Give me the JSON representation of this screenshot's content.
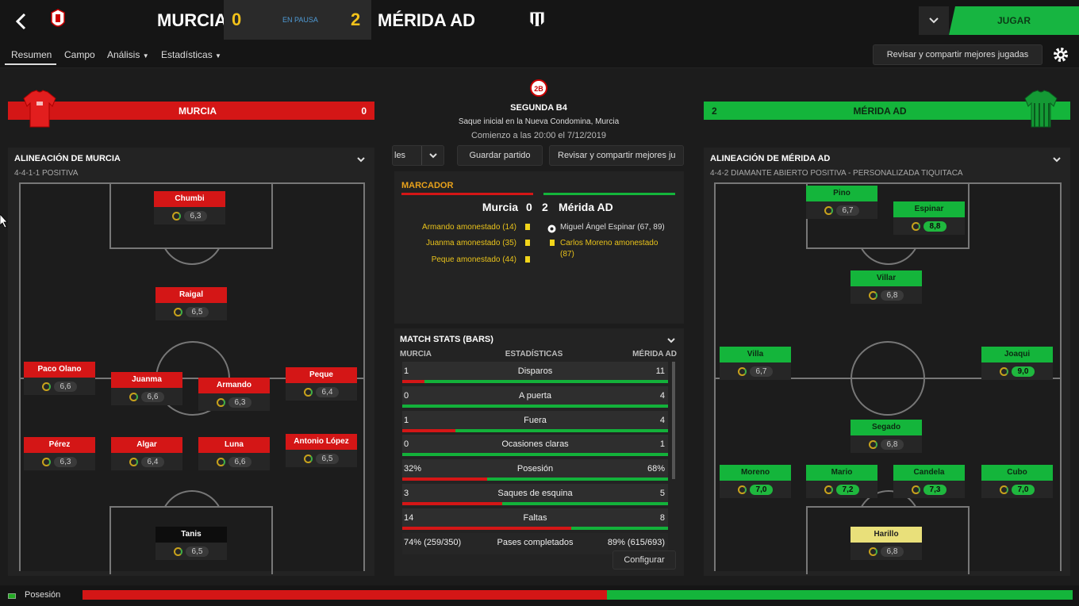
{
  "header": {
    "home_team": "MURCIA",
    "away_team": "MÉRIDA AD",
    "home_score": "0",
    "away_score": "2",
    "status": "EN PAUSA",
    "play_label": "JUGAR"
  },
  "nav": {
    "tabs": [
      "Resumen",
      "Campo",
      "Análisis",
      "Estadísticas"
    ],
    "share_label": "Revisar y compartir mejores jugadas"
  },
  "match": {
    "competition": "SEGUNDA B4",
    "kickoff": "Saque inicial en la Nueva Condomina, Murcia",
    "start": "Comienzo a las 20:00 el 7/12/2019",
    "dropdown_label": "les",
    "save_label": "Guardar partido",
    "share_label": "Revisar y compartir mejores ju"
  },
  "home": {
    "banner_name": "MURCIA",
    "banner_score": "0",
    "lineup_title": "ALINEACIÓN DE MURCIA",
    "formation": "4-4-1-1 POSITIVA",
    "players": [
      {
        "name": "Chumbi",
        "rating": "6,3"
      },
      {
        "name": "Raigal",
        "rating": "6,5"
      },
      {
        "name": "Paco Olano",
        "rating": "6,6"
      },
      {
        "name": "Juanma",
        "rating": "6,6"
      },
      {
        "name": "Armando",
        "rating": "6,3"
      },
      {
        "name": "Peque",
        "rating": "6,4"
      },
      {
        "name": "Pérez",
        "rating": "6,3"
      },
      {
        "name": "Algar",
        "rating": "6,4"
      },
      {
        "name": "Luna",
        "rating": "6,6"
      },
      {
        "name": "Antonio López",
        "rating": "6,5"
      },
      {
        "name": "Tanis",
        "rating": "6,5"
      }
    ]
  },
  "away": {
    "banner_name": "MÉRIDA AD",
    "banner_score": "2",
    "lineup_title": "ALINEACIÓN DE MÉRIDA AD",
    "formation": "4-4-2 DIAMANTE ABIERTO POSITIVA - PERSONALIZADA TIQUITACA",
    "players": [
      {
        "name": "Pino",
        "rating": "6,7"
      },
      {
        "name": "Espinar",
        "rating": "8,8"
      },
      {
        "name": "Villar",
        "rating": "6,8"
      },
      {
        "name": "Villa",
        "rating": "6,7"
      },
      {
        "name": "Joaqui",
        "rating": "9,0"
      },
      {
        "name": "Segado",
        "rating": "6,8"
      },
      {
        "name": "Moreno",
        "rating": "7,0"
      },
      {
        "name": "Mario",
        "rating": "7,2"
      },
      {
        "name": "Candela",
        "rating": "7,3"
      },
      {
        "name": "Cubo",
        "rating": "7,0"
      },
      {
        "name": "Harillo",
        "rating": "6,8"
      }
    ]
  },
  "scoreboard": {
    "title": "MARCADOR",
    "home": "Murcia",
    "home_score": "0",
    "away_score": "2",
    "away": "Mérida AD",
    "home_events": [
      "Armando amonestado (14)",
      "Juanma amonestado (35)",
      "Peque amonestado (44)"
    ],
    "away_goal": "Miguel Ángel Espinar (67, 89)",
    "away_booking": "Carlos Moreno amonestado",
    "away_booking_min": "(87)"
  },
  "stats": {
    "title": "MATCH STATS (BARS)",
    "col_home": "MURCIA",
    "col_mid": "ESTADÍSTICAS",
    "col_away": "MÉRIDA AD",
    "configure_label": "Configurar",
    "rows": [
      {
        "label": "Disparos",
        "home": "1",
        "away": "11",
        "home_share": 0.083
      },
      {
        "label": "A puerta",
        "home": "0",
        "away": "4",
        "home_share": 0
      },
      {
        "label": "Fuera",
        "home": "1",
        "away": "4",
        "home_share": 0.2
      },
      {
        "label": "Ocasiones claras",
        "home": "0",
        "away": "1",
        "home_share": 0
      },
      {
        "label": "Posesión",
        "home": "32%",
        "away": "68%",
        "home_share": 0.32
      },
      {
        "label": "Saques de esquina",
        "home": "3",
        "away": "5",
        "home_share": 0.375
      },
      {
        "label": "Faltas",
        "home": "14",
        "away": "8",
        "home_share": 0.636
      },
      {
        "label": "Pases completados",
        "home": "74% (259/350)",
        "away": "89% (615/693)",
        "home_share": null
      }
    ]
  },
  "possession": {
    "label": "Posesión",
    "home_share": 0.53
  },
  "colors": {
    "home": "#d41616",
    "away": "#14b53b",
    "accent": "#e8c21b"
  }
}
